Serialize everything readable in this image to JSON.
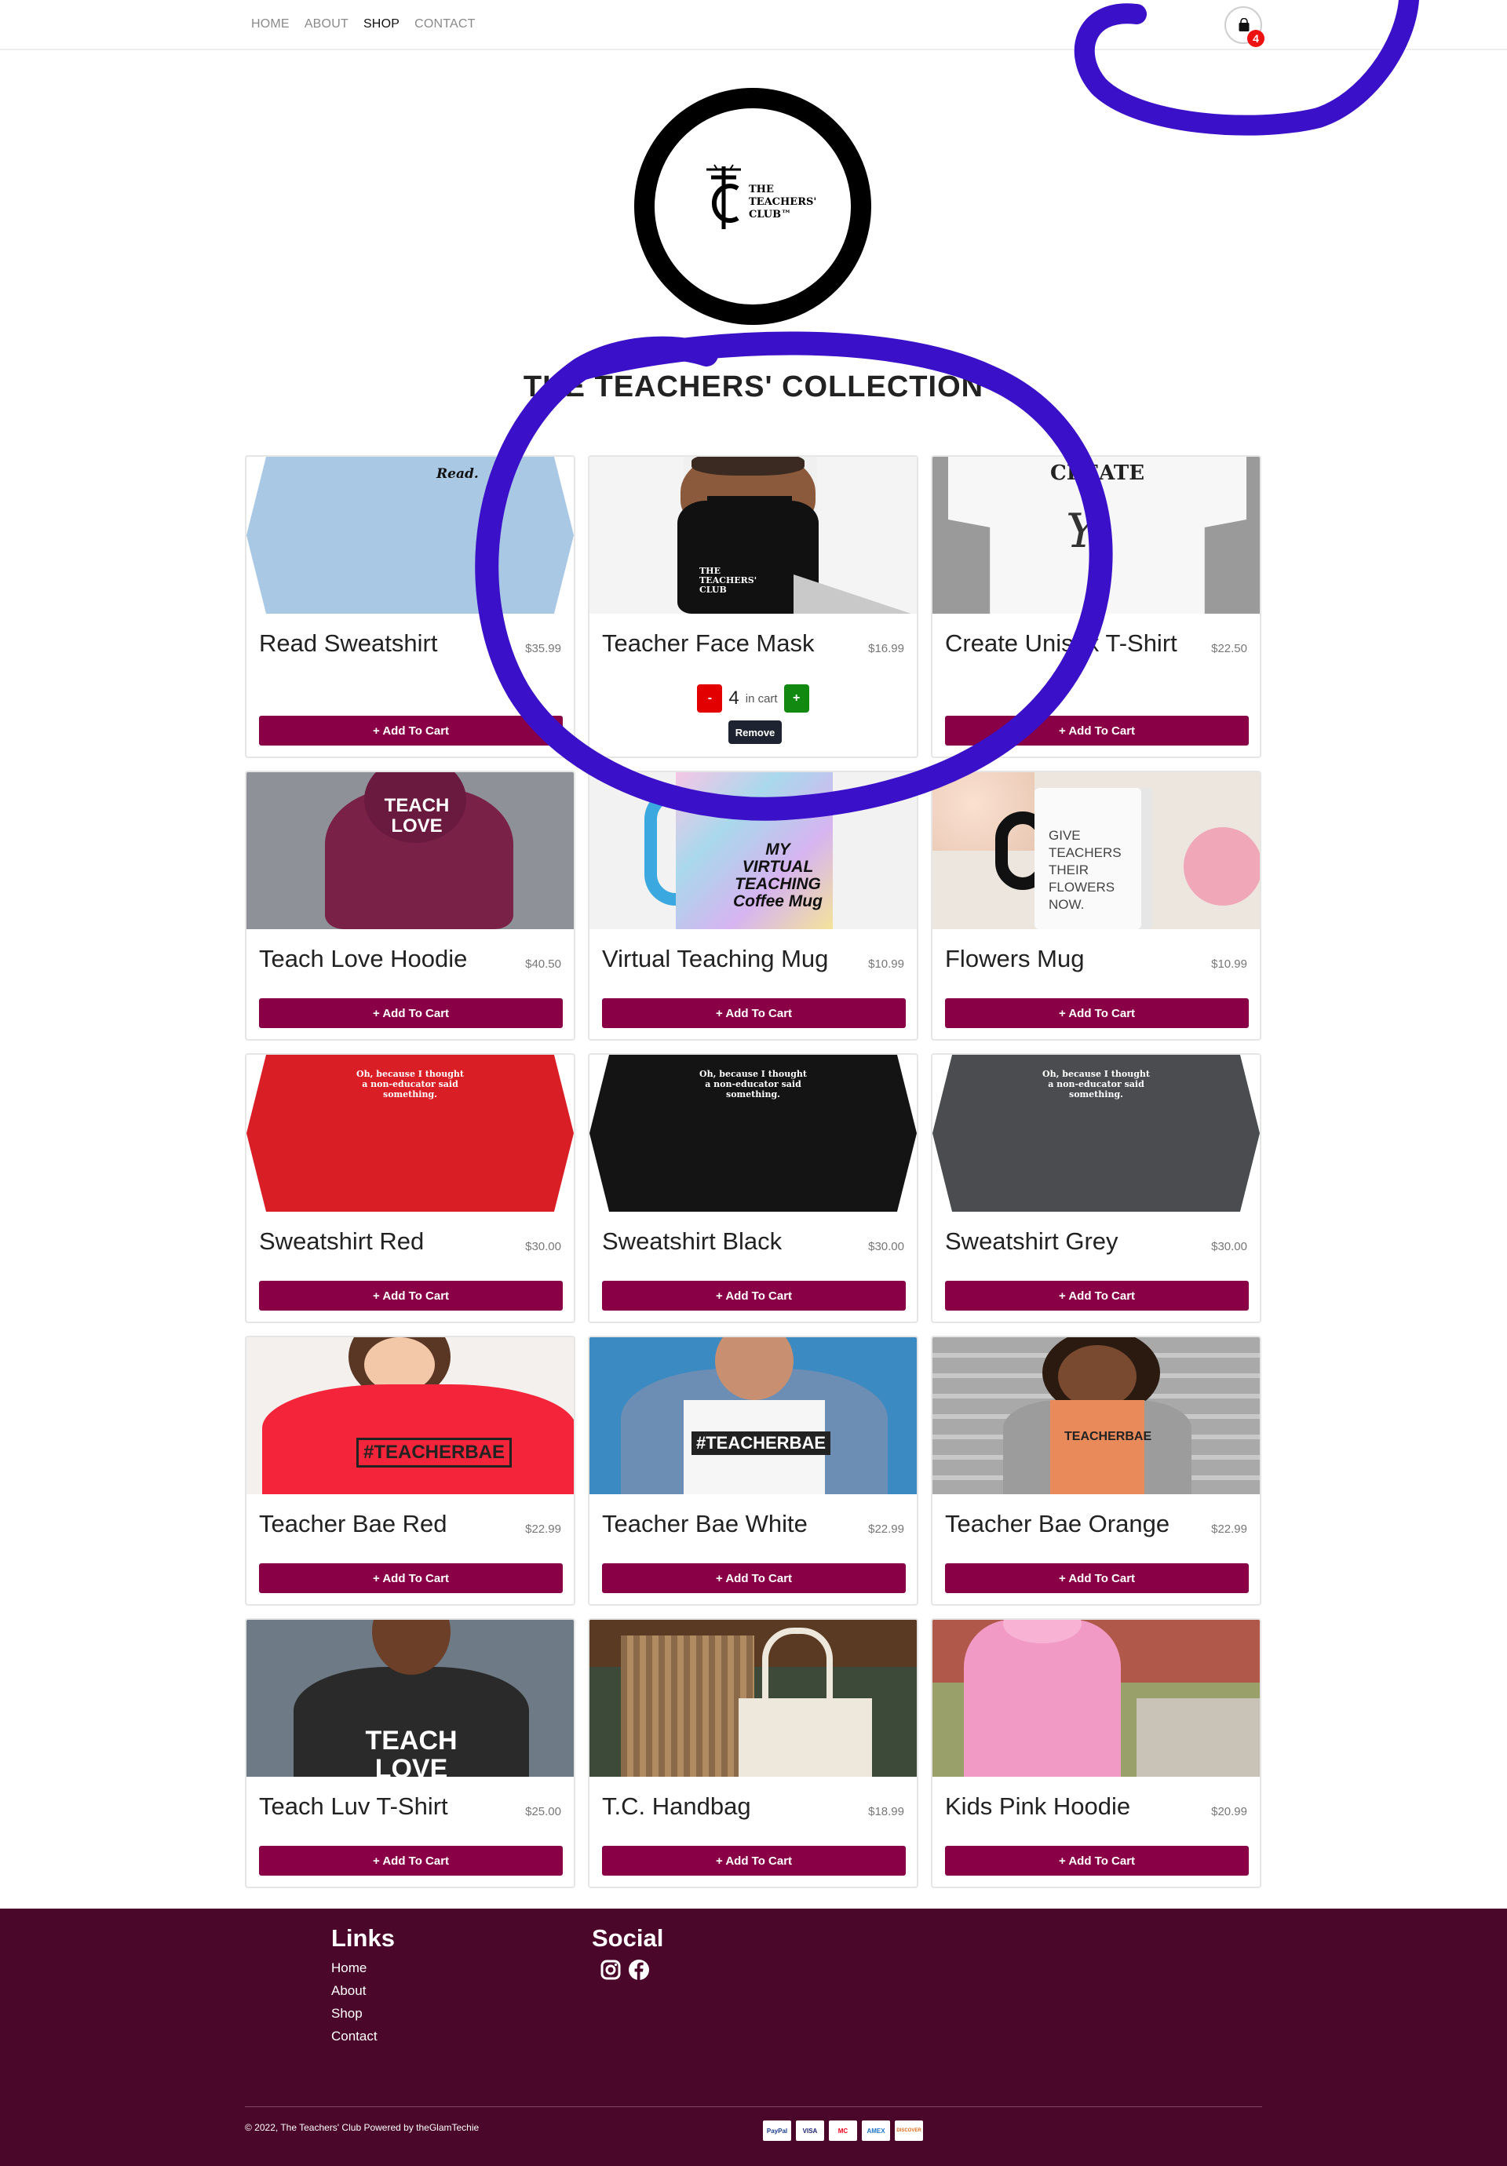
{
  "nav": {
    "links": [
      "HOME",
      "ABOUT",
      "SHOP",
      "CONTACT"
    ],
    "cart_count": "4"
  },
  "logo": {
    "line1": "THE",
    "line2": "TEACHERS'",
    "line3": "CLUB™"
  },
  "title": "THE TEACHERS' COLLECTION",
  "products": [
    {
      "name": "Read Sweatshirt",
      "price": "$35.99",
      "image_text": "Read."
    },
    {
      "name": "Teacher Face Mask",
      "price": "$16.99",
      "image_text": "THE TEACHERS' CLUB"
    },
    {
      "name": "Create Unisex T-Shirt",
      "price": "$22.50",
      "image_text": "CREATE"
    },
    {
      "name": "Teach Love Hoodie",
      "price": "$40.50",
      "image_text": "TEACH LOVE"
    },
    {
      "name": "Virtual Teaching Mug",
      "price": "$10.99",
      "image_text": "MY VIRTUAL TEACHING Coffee Mug"
    },
    {
      "name": "Flowers Mug",
      "price": "$10.99",
      "image_text": "GIVE TEACHERS THEIR FLOWERS NOW."
    },
    {
      "name": "Sweatshirt Red",
      "price": "$30.00",
      "image_text": "Oh, because I thought a non-educator said something."
    },
    {
      "name": "Sweatshirt Black",
      "price": "$30.00",
      "image_text": "Oh, because I thought a non-educator said something."
    },
    {
      "name": "Sweatshirt Grey",
      "price": "$30.00",
      "image_text": "Oh, because I thought a non-educator said something."
    },
    {
      "name": "Teacher Bae Red",
      "price": "$22.99",
      "image_text": "#TEACHERBAE"
    },
    {
      "name": "Teacher Bae White",
      "price": "$22.99",
      "image_text": "#TEACHERBAE"
    },
    {
      "name": "Teacher Bae Orange",
      "price": "$22.99",
      "image_text": "TEACHERBAE"
    },
    {
      "name": "Teach Luv T-Shirt",
      "price": "$25.00",
      "image_text": "TEACH LOVE"
    },
    {
      "name": "T.C. Handbag",
      "price": "$18.99",
      "image_text": ""
    },
    {
      "name": "Kids Pink Hoodie",
      "price": "$20.99",
      "image_text": ""
    }
  ],
  "cart_controls": {
    "minus": "-",
    "plus": "+",
    "quantity": "4",
    "in_cart": "in cart",
    "remove": "Remove"
  },
  "add_to_cart": "+ Add To Cart",
  "footer": {
    "links_title": "Links",
    "links": [
      "Home",
      "About",
      "Shop",
      "Contact"
    ],
    "social_title": "Social",
    "copyright": "© 2022, The Teachers' Club Powered by theGlamTechie",
    "payments": [
      "PayPal",
      "VISA",
      "MC",
      "AMEX",
      "DISCOVER"
    ]
  },
  "colors": {
    "accent": "#8a0046",
    "footer": "#4a0729",
    "scribble": "#3a10c8"
  }
}
